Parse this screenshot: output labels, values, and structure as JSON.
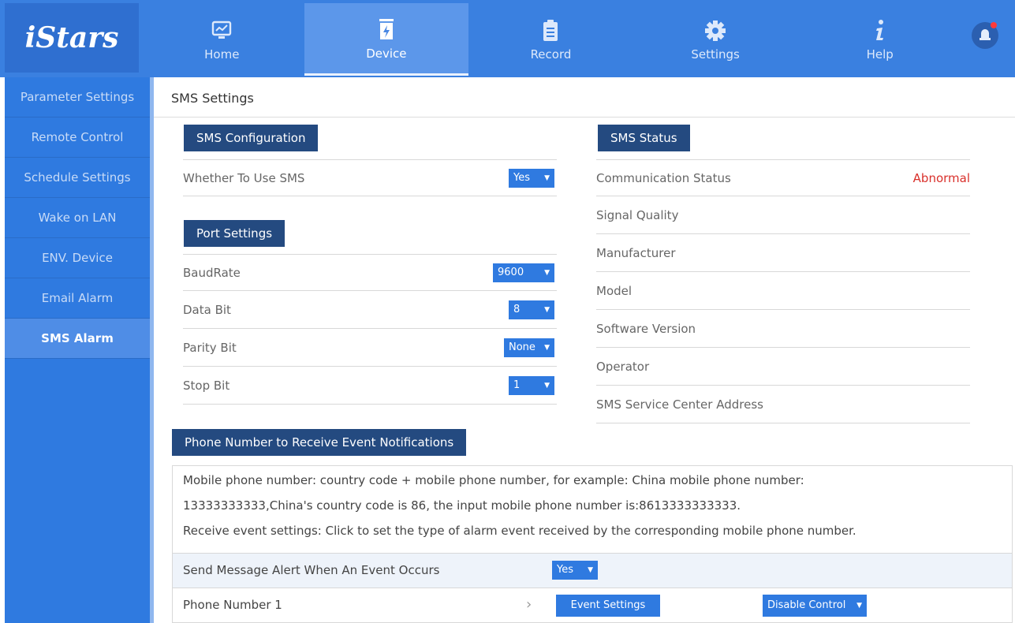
{
  "brand": {
    "logo_text": "iStars"
  },
  "nav": {
    "items": [
      {
        "label": "Home",
        "icon": "monitor-chart-icon"
      },
      {
        "label": "Device",
        "icon": "device-icon",
        "active": true
      },
      {
        "label": "Record",
        "icon": "clipboard-icon"
      },
      {
        "label": "Settings",
        "icon": "gear-icon"
      },
      {
        "label": "Help",
        "icon": "info-icon"
      }
    ],
    "alarm_icon": "alarm-bell-icon"
  },
  "sidebar": {
    "items": [
      {
        "label": "Parameter Settings"
      },
      {
        "label": "Remote Control"
      },
      {
        "label": "Schedule Settings"
      },
      {
        "label": "Wake on LAN"
      },
      {
        "label": "ENV. Device"
      },
      {
        "label": "Email Alarm"
      },
      {
        "label": "SMS Alarm",
        "active": true
      }
    ]
  },
  "page": {
    "title": "SMS Settings"
  },
  "sms_config": {
    "heading": "SMS Configuration",
    "use_sms": {
      "label": "Whether To Use SMS",
      "value": "Yes"
    }
  },
  "port_settings": {
    "heading": "Port Settings",
    "rows": [
      {
        "label": "BaudRate",
        "value": "9600"
      },
      {
        "label": "Data Bit",
        "value": "8"
      },
      {
        "label": "Parity Bit",
        "value": "None"
      },
      {
        "label": "Stop Bit",
        "value": "1"
      }
    ]
  },
  "sms_status": {
    "heading": "SMS Status",
    "rows": [
      {
        "label": "Communication Status",
        "value": "Abnormal"
      },
      {
        "label": "Signal Quality",
        "value": ""
      },
      {
        "label": "Manufacturer",
        "value": ""
      },
      {
        "label": "Model",
        "value": ""
      },
      {
        "label": "Software Version",
        "value": ""
      },
      {
        "label": "Operator",
        "value": ""
      },
      {
        "label": "SMS Service Center Address",
        "value": ""
      }
    ]
  },
  "phone_notify": {
    "heading": "Phone Number to Receive Event Notifications",
    "notes": [
      "Mobile phone number: country code + mobile phone number, for example: China mobile phone number:",
      "13333333333,China's country code is 86, the input mobile phone number is:8613333333333.",
      "Receive event settings: Click to set the type of alarm event received by the corresponding mobile phone number."
    ],
    "send_alert": {
      "label": "Send Message Alert When An Event Occurs",
      "value": "Yes"
    },
    "phone1": {
      "label": "Phone Number 1",
      "arrow": "›",
      "event_button": "Event Settings",
      "control_value": "Disable Control"
    }
  },
  "colors": {
    "header": "#3a80e0",
    "sidebar": "#2f7ae0",
    "section_heading": "#244a80",
    "abnormal": "#d9302b"
  }
}
